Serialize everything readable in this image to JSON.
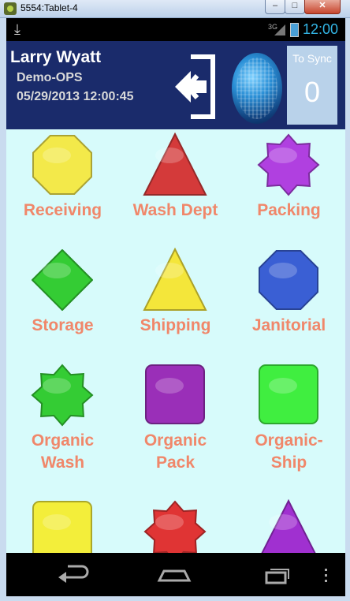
{
  "window": {
    "title": "5554:Tablet-4",
    "minimize": "–",
    "maximize": "□",
    "close": "✕"
  },
  "statusbar": {
    "network": "3G",
    "time": "12:00",
    "icons": [
      "download-icon",
      "signal-icon",
      "battery-icon"
    ]
  },
  "header": {
    "user": "Larry Wyatt",
    "org": "Demo-OPS",
    "datetime": "05/29/2013 12:00:45",
    "sync_label": "To Sync",
    "sync_count": "0",
    "icons": [
      "logout-icon",
      "globe-icon"
    ]
  },
  "tiles": [
    {
      "label": "Receiving",
      "shape": "octagon",
      "color": "#f3e94a"
    },
    {
      "label": "Wash Dept",
      "shape": "triangle",
      "color": "#d43a3a"
    },
    {
      "label": "Packing",
      "shape": "star8",
      "color": "#b040e0"
    },
    {
      "label": "Storage",
      "shape": "diamond",
      "color": "#34cc34"
    },
    {
      "label": "Shipping",
      "shape": "triangle",
      "color": "#f4e63a"
    },
    {
      "label": "Janitorial",
      "shape": "octagon",
      "color": "#3a5fd4"
    },
    {
      "label": "Organic Wash",
      "shape": "star8",
      "color": "#34cc34"
    },
    {
      "label": "Organic Pack",
      "shape": "square",
      "color": "#9a2fb8"
    },
    {
      "label": "Organic-Ship",
      "shape": "square",
      "color": "#40ee40"
    },
    {
      "label": "",
      "shape": "square",
      "color": "#f3ee3a"
    },
    {
      "label": "",
      "shape": "star8",
      "color": "#e03434"
    },
    {
      "label": "",
      "shape": "triangle",
      "color": "#a030d0"
    }
  ],
  "navbar": {
    "icons": [
      "back-icon",
      "home-icon",
      "recent-apps-icon",
      "menu-icon"
    ]
  }
}
